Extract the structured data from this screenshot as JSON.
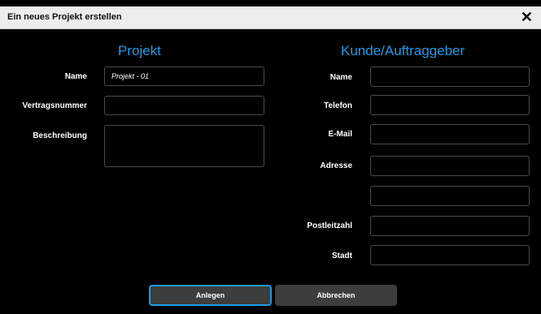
{
  "dialog": {
    "title": "Ein neues Projekt erstellen",
    "close_symbol": "✕"
  },
  "project": {
    "heading": "Projekt",
    "name_label": "Name",
    "name_value": "Projekt - 01",
    "contract_label": "Vertragsnummer",
    "contract_value": "",
    "description_label": "Beschreibung",
    "description_value": ""
  },
  "customer": {
    "heading": "Kunde/Auftraggeber",
    "name_label": "Name",
    "phone_label": "Telefon",
    "email_label": "E-Mail",
    "address_label": "Adresse",
    "zip_label": "Postleitzahl",
    "city_label": "Stadt"
  },
  "buttons": {
    "create_label": "Anlegen",
    "cancel_label": "Abbrechen"
  },
  "colors": {
    "accent": "#1e9be8",
    "background": "#000000",
    "titlebar": "#ededed",
    "button": "#3d3d3d"
  }
}
